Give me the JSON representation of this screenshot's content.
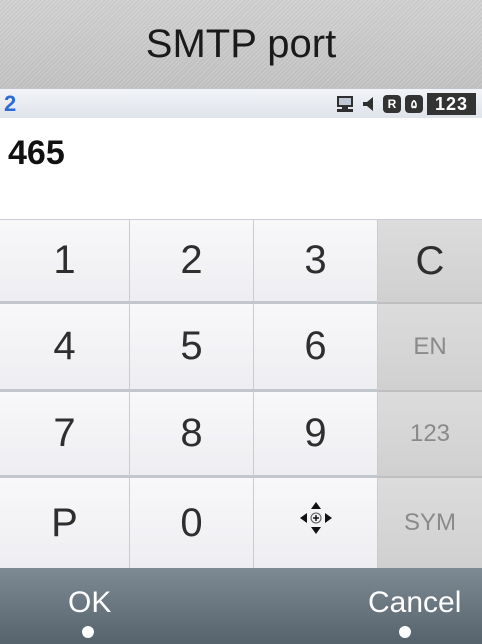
{
  "title": "SMTP port",
  "status": {
    "char_count": "2",
    "icons": [
      "pc-connection-icon",
      "speaker-icon",
      "r-box-icon",
      "box-icon"
    ],
    "r_letter": "R",
    "box_letter": "۵",
    "mode": "123"
  },
  "input": {
    "value": "465"
  },
  "keypad": {
    "keys": [
      {
        "label": "1",
        "type": "digit"
      },
      {
        "label": "2",
        "type": "digit"
      },
      {
        "label": "3",
        "type": "digit"
      },
      {
        "label": "C",
        "type": "function"
      },
      {
        "label": "4",
        "type": "digit"
      },
      {
        "label": "5",
        "type": "digit"
      },
      {
        "label": "6",
        "type": "digit"
      },
      {
        "label": "EN",
        "type": "function"
      },
      {
        "label": "7",
        "type": "digit"
      },
      {
        "label": "8",
        "type": "digit"
      },
      {
        "label": "9",
        "type": "digit"
      },
      {
        "label": "123",
        "type": "function"
      },
      {
        "label": "P",
        "type": "digit"
      },
      {
        "label": "0",
        "type": "digit"
      },
      {
        "label": "",
        "type": "navigation",
        "icon": "four-way-navigation-icon"
      },
      {
        "label": "SYM",
        "type": "function"
      }
    ]
  },
  "softkeys": {
    "left": "OK",
    "right": "Cancel"
  },
  "colors": {
    "title_bg": "#c8c8c8",
    "char_count": "#2b6cd8",
    "key_bg": "#f4f4f6",
    "function_key_bg": "#d4d4d4",
    "softkey_bg": "#66737c"
  }
}
